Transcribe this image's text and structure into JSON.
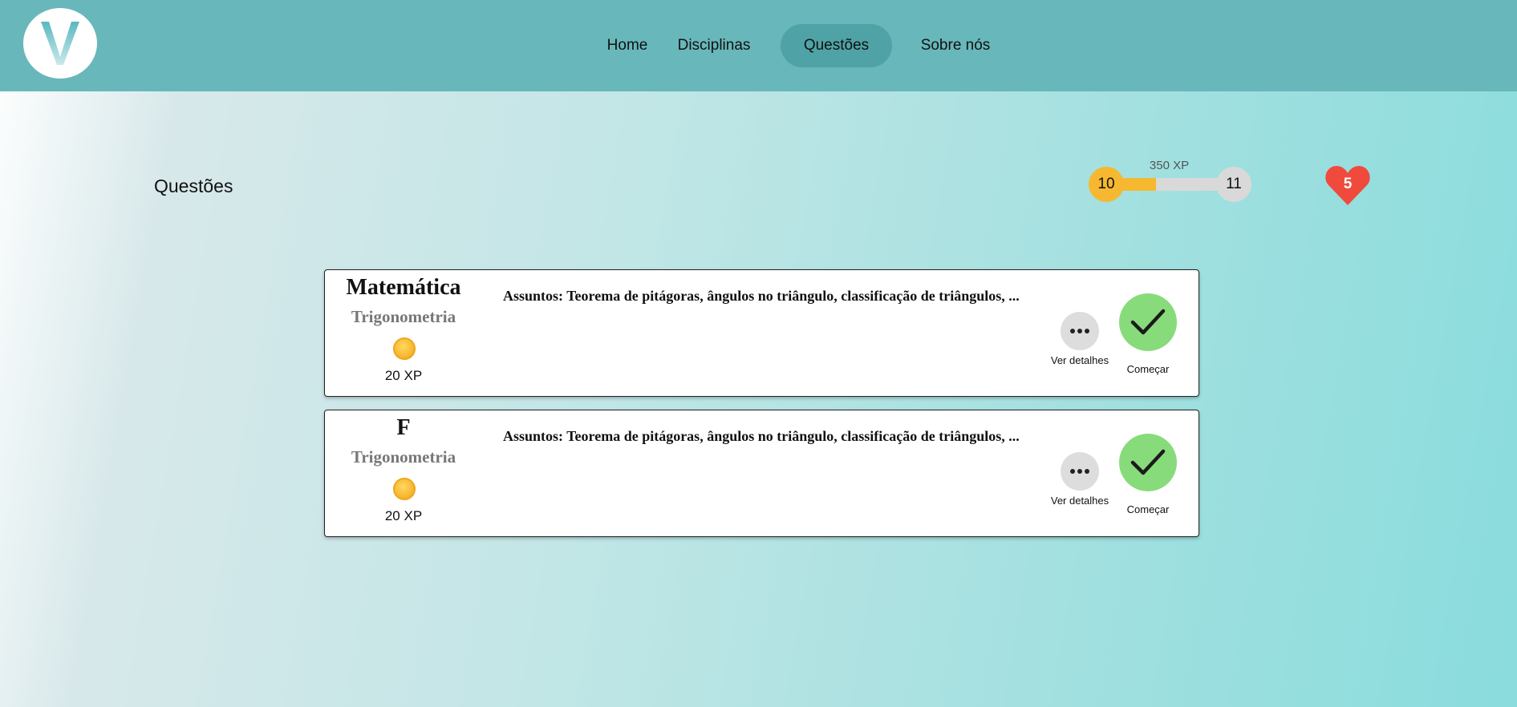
{
  "header": {
    "nav": [
      {
        "label": "Home"
      },
      {
        "label": "Disciplinas"
      },
      {
        "label": "Questões"
      },
      {
        "label": "Sobre nós"
      }
    ]
  },
  "page": {
    "title": "Questões"
  },
  "progress": {
    "xp_label": "350 XP",
    "current_level": "10",
    "next_level": "11",
    "fill_fraction": 0.4
  },
  "lives": {
    "count": "5",
    "color": "#f04a3c"
  },
  "cards": [
    {
      "subject": "Matemática",
      "topic": "Trigonometria",
      "xp": "20 XP",
      "topics": "Assuntos: Teorema de pitágoras, ângulos no triângulo, classificação de triângulos, ...",
      "details_label": "Ver detalhes",
      "start_label": "Começar"
    },
    {
      "subject": "F",
      "topic": "Trigonometria",
      "xp": "20 XP",
      "topics": "Assuntos: Teorema de pitágoras, ângulos no triângulo, classificação de triângulos, ...",
      "details_label": "Ver detalhes",
      "start_label": "Começar"
    }
  ],
  "colors": {
    "header": "#68b7bb",
    "active_nav": "#4fa3a6",
    "xp_fill": "#f5b830",
    "start_button": "#88db7b"
  }
}
